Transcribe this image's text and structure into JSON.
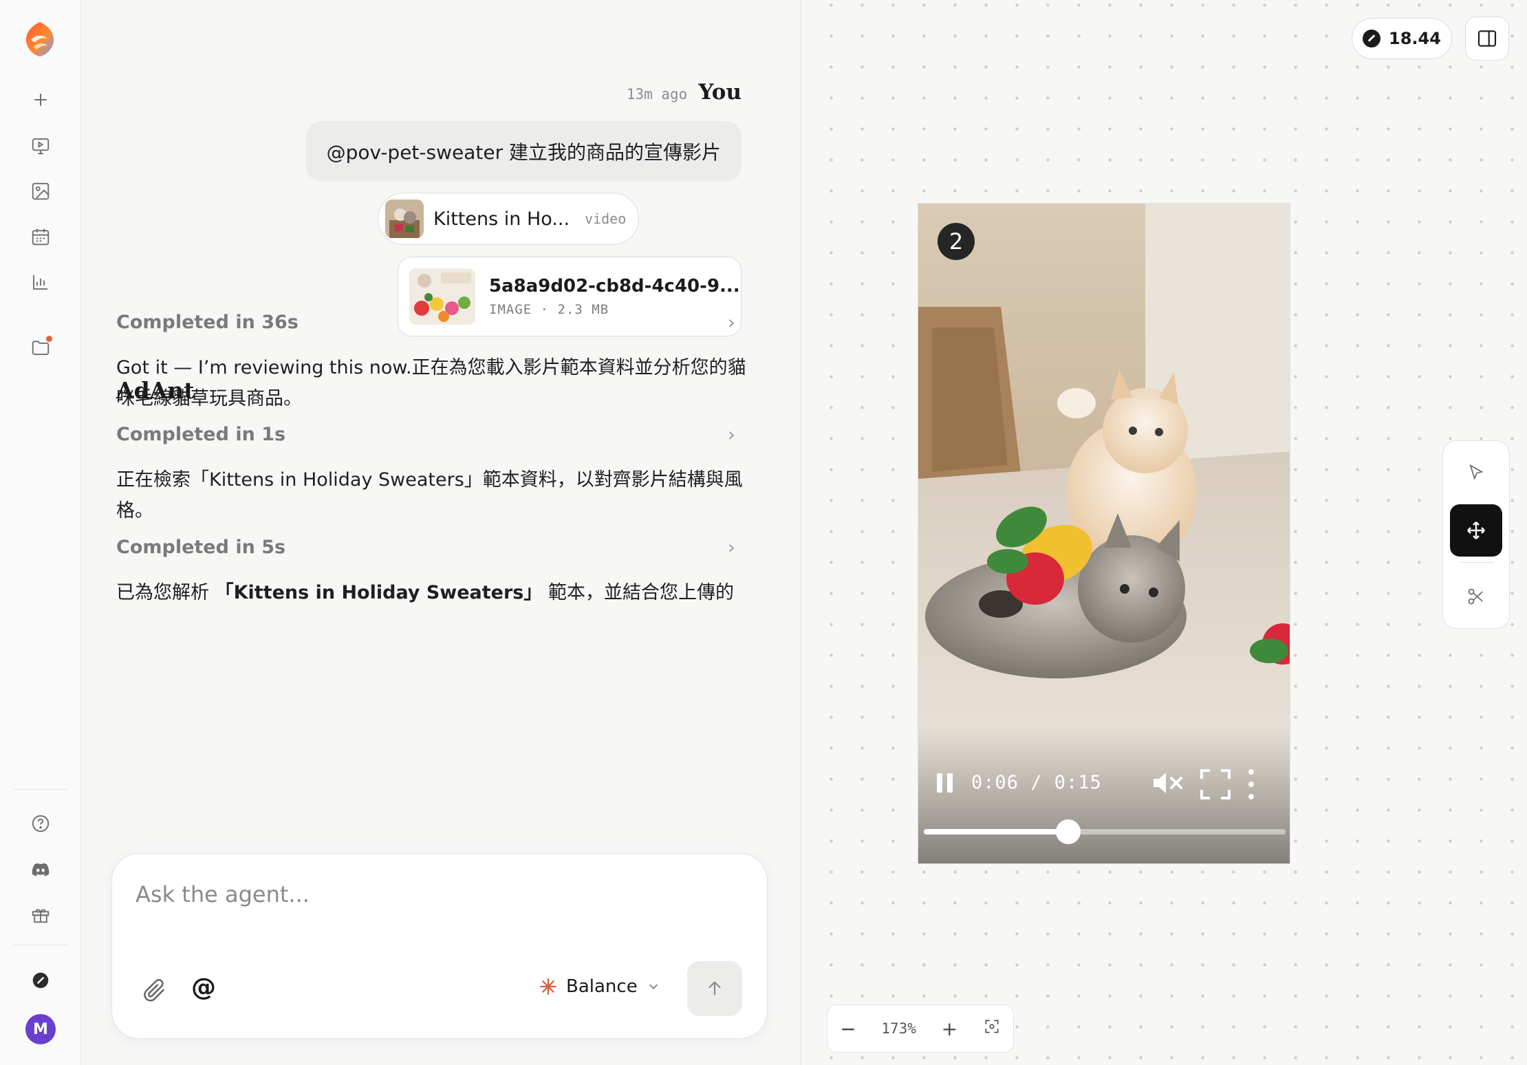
{
  "user_message": {
    "timestamp": "13m ago",
    "author": "You",
    "text": "@pov-pet-sweater 建立我的商品的宣傳影片",
    "attachments": [
      {
        "title": "Kittens in Ho...",
        "kind": "video"
      },
      {
        "title": "5a8a9d02-cb8d-4c40-9...",
        "meta": "IMAGE · 2.3 MB"
      }
    ]
  },
  "agent": {
    "name": "AdAnt",
    "steps": [
      {
        "label": "Completed in 36s",
        "message": "Got it — I’m reviewing this now.正在為您載入影片範本資料並分析您的貓咪毛線貓草玩具商品。"
      },
      {
        "label": "Completed in 1s",
        "message": "正在檢索「Kittens in Holiday Sweaters」範本資料，以對齊影片結構與風格。"
      },
      {
        "label": "Completed in 5s",
        "message_prefix": "已為您解析 ",
        "message_bold": "「Kittens in Holiday Sweaters」",
        "message_suffix": " 範本，並結合您上傳的"
      }
    ]
  },
  "composer": {
    "placeholder": "Ask the agent...",
    "at_symbol": "@",
    "mode": "Balance"
  },
  "canvas": {
    "credits": "18.44",
    "zoom": "173%",
    "video": {
      "scene_number": "2",
      "current_time": "0:06",
      "duration": "0:15",
      "time_display": "0:06 / 0:15",
      "progress": 0.4,
      "muted": true
    },
    "tools": [
      "select-tool",
      "move-tool",
      "cut-tool"
    ],
    "active_tool": "move-tool"
  },
  "sidebar": {
    "avatar_initial": "M",
    "items": [
      "new",
      "video-studio",
      "images",
      "calendar",
      "analytics",
      "files",
      "help",
      "discord",
      "gift",
      "credits"
    ]
  }
}
